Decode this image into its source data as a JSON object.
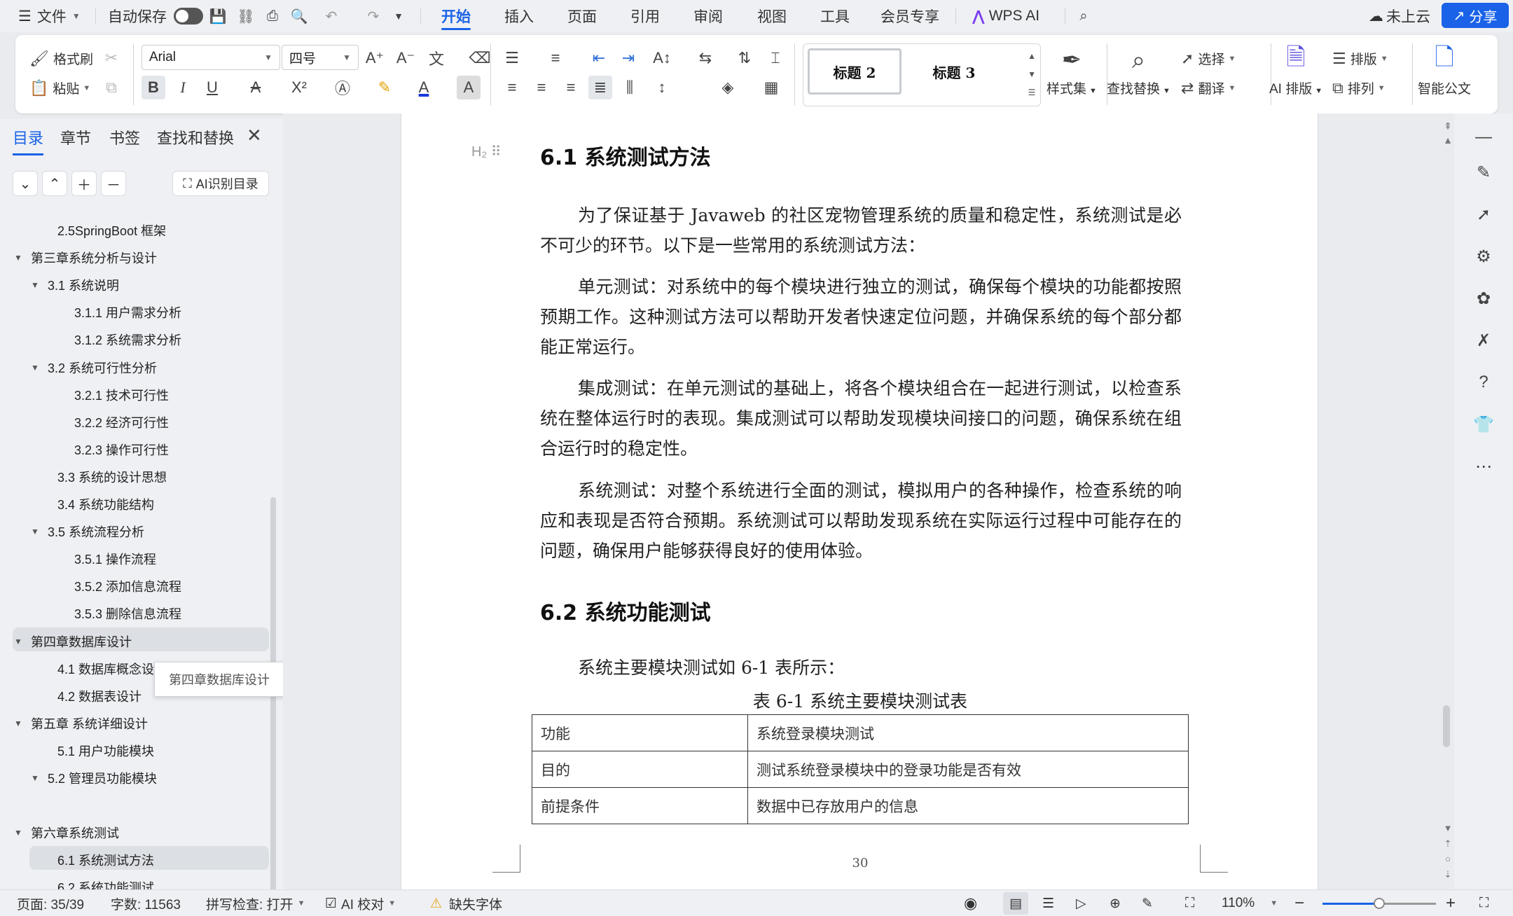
{
  "menubar": {
    "file": "文件",
    "autosave": "自动保存",
    "tabs": [
      "开始",
      "插入",
      "页面",
      "引用",
      "审阅",
      "视图",
      "工具",
      "会员专享"
    ],
    "wps_ai": "WPS AI",
    "cloud": "未上云",
    "share": "分享"
  },
  "ribbon": {
    "format_painter": "格式刷",
    "paste": "粘贴",
    "font_name": "Arial",
    "font_size": "四号",
    "styles": [
      "标题 2",
      "标题 3"
    ],
    "style_set": "样式集",
    "find_replace": "查找替换",
    "select": "选择",
    "translate": "翻译",
    "ai_layout": "AI 排版",
    "layout": "排版",
    "arrange": "排列",
    "smart_doc": "智能公文"
  },
  "nav": {
    "tabs": [
      "目录",
      "章节",
      "书签",
      "查找和替换"
    ],
    "ai_toc": "AI识别目录",
    "items": [
      {
        "label": "2.5SpringBoot 框架",
        "level": 2,
        "collapsible": false
      },
      {
        "label": "第三章系统分析与设计",
        "level": 1,
        "collapsible": true
      },
      {
        "label": "3.1 系统说明",
        "level": 2,
        "collapsible": true
      },
      {
        "label": "3.1.1    用户需求分析",
        "level": 3,
        "collapsible": false
      },
      {
        "label": "3.1.2    系统需求分析",
        "level": 3,
        "collapsible": false
      },
      {
        "label": "3.2 系统可行性分析",
        "level": 2,
        "collapsible": true
      },
      {
        "label": "3.2.1  技术可行性",
        "level": 3,
        "collapsible": false
      },
      {
        "label": "3.2.2  经济可行性",
        "level": 3,
        "collapsible": false
      },
      {
        "label": "3.2.3  操作可行性",
        "level": 3,
        "collapsible": false
      },
      {
        "label": "3.3 系统的设计思想",
        "level": 2,
        "collapsible": false
      },
      {
        "label": "3.4 系统功能结构",
        "level": 2,
        "collapsible": false
      },
      {
        "label": "3.5 系统流程分析",
        "level": 2,
        "collapsible": true
      },
      {
        "label": "3.5.1 操作流程",
        "level": 3,
        "collapsible": false
      },
      {
        "label": "3.5.2 添加信息流程",
        "level": 3,
        "collapsible": false
      },
      {
        "label": "3.5.3 删除信息流程",
        "level": 3,
        "collapsible": false
      },
      {
        "label": "第四章数据库设计",
        "level": 1,
        "collapsible": true
      },
      {
        "label": "4.1 数据库概念设",
        "level": 2,
        "collapsible": false
      },
      {
        "label": "4.2 数据表设计",
        "level": 2,
        "collapsible": false
      },
      {
        "label": "第五章  系统详细设计",
        "level": 1,
        "collapsible": true
      },
      {
        "label": "5.1 用户功能模块",
        "level": 2,
        "collapsible": false
      },
      {
        "label": "5.2 管理员功能模块",
        "level": 2,
        "collapsible": true
      },
      {
        "label": "第六章系统测试",
        "level": 1,
        "collapsible": true
      },
      {
        "label": "6.1 系统测试方法",
        "level": 2,
        "collapsible": false
      },
      {
        "label": "6.2 系统功能测试",
        "level": 2,
        "collapsible": false
      }
    ],
    "tooltip": "第四章数据库设计"
  },
  "document": {
    "heading_handle": "H₂ ⠿",
    "h1": "6.1 系统测试方法",
    "p1": "为了保证基于 Javaweb 的社区宠物管理系统的质量和稳定性，系统测试是必不可少的环节。以下是一些常用的系统测试方法：",
    "p2": "单元测试：对系统中的每个模块进行独立的测试，确保每个模块的功能都按照预期工作。这种测试方法可以帮助开发者快速定位问题，并确保系统的每个部分都能正常运行。",
    "p3": "集成测试：在单元测试的基础上，将各个模块组合在一起进行测试，以检查系统在整体运行时的表现。集成测试可以帮助发现模块间接口的问题，确保系统在组合运行时的稳定性。",
    "p4": "系统测试：对整个系统进行全面的测试，模拟用户的各种操作，检查系统的响应和表现是否符合预期。系统测试可以帮助发现系统在实际运行过程中可能存在的问题，确保用户能够获得良好的使用体验。",
    "h2": "6.2 系统功能测试",
    "p5": "系统主要模块测试如 6-1 表所示：",
    "table_caption": "表 6-1 系统主要模块测试表",
    "table": [
      [
        "功能",
        "系统登录模块测试"
      ],
      [
        "目的",
        "测试系统登录模块中的登录功能是否有效"
      ],
      [
        "前提条件",
        "数据中已存放用户的信息"
      ]
    ],
    "page_number": "30"
  },
  "status": {
    "page": "页面: 35/39",
    "words": "字数: 11563",
    "spell": "拼写检查: 打开",
    "ai_proof": "AI 校对",
    "missing_font": "缺失字体",
    "zoom": "110%",
    "zoom_level": 0.5
  },
  "colors": {
    "accent": "#1a62e8",
    "warning": "#e8a21a"
  }
}
